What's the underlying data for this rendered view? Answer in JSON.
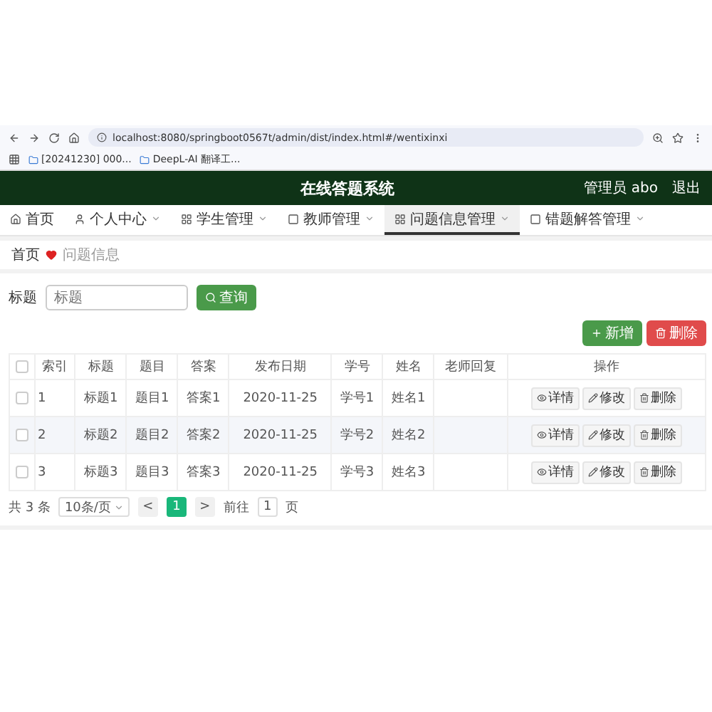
{
  "browser": {
    "url": "localhost:8080/springboot0567t/admin/dist/index.html#/wentixinxi",
    "bookmarks": [
      "[20241230] 000...",
      "DeepL-AI 翻译工..."
    ]
  },
  "header": {
    "title": "在线答题系统",
    "user": "管理员 abo",
    "logout": "退出"
  },
  "nav": [
    {
      "label": "首页",
      "selected": false
    },
    {
      "label": "个人中心",
      "selected": false
    },
    {
      "label": "学生管理",
      "selected": false
    },
    {
      "label": "教师管理",
      "selected": false
    },
    {
      "label": "问题信息管理",
      "selected": true
    },
    {
      "label": "错题解答管理",
      "selected": false
    }
  ],
  "breadcrumb": [
    "首页",
    "问题信息"
  ],
  "search": {
    "label": "标题",
    "placeholder": "标题",
    "button": "查询"
  },
  "actions": [
    {
      "label": "新增",
      "kind": "add"
    },
    {
      "label": "删除",
      "kind": "delete"
    }
  ],
  "table": {
    "columns": [
      "索引",
      "标题",
      "题目",
      "答案",
      "发布日期",
      "学号",
      "姓名",
      "老师回复",
      "操作"
    ],
    "header_checked": false,
    "rows": [
      {
        "checked": false,
        "cells": [
          "1",
          "标题1",
          "题目1",
          "答案1",
          "2020-11-25",
          "学号1",
          "姓名1"
        ],
        "buttons": [
          {
            "label": "详情",
            "kind": "detail"
          },
          {
            "label": "修改",
            "kind": "edit"
          },
          {
            "label": "删除",
            "kind": "delete"
          }
        ]
      },
      {
        "checked": false,
        "cells": [
          "2",
          "标题2",
          "题目2",
          "答案2",
          "2020-11-25",
          "学号2",
          "姓名2"
        ],
        "buttons": [
          {
            "label": "详情",
            "kind": "detail"
          },
          {
            "label": "修改",
            "kind": "edit"
          },
          {
            "label": "删除",
            "kind": "delete"
          }
        ]
      },
      {
        "checked": false,
        "cells": [
          "3",
          "标题3",
          "题目3",
          "答案3",
          "2020-11-25",
          "学号3",
          "姓名3"
        ],
        "buttons": [
          {
            "label": "详情",
            "kind": "detail"
          },
          {
            "label": "修改",
            "kind": "edit"
          },
          {
            "label": "删除",
            "kind": "delete"
          }
        ]
      }
    ]
  },
  "pagination": {
    "total": "共 3 条",
    "size": "10条/页",
    "prev": "<",
    "pages": [
      {
        "label": "1",
        "selected": true
      }
    ],
    "next": ">",
    "goto": "前往",
    "page": "1",
    "unit": "页"
  }
}
